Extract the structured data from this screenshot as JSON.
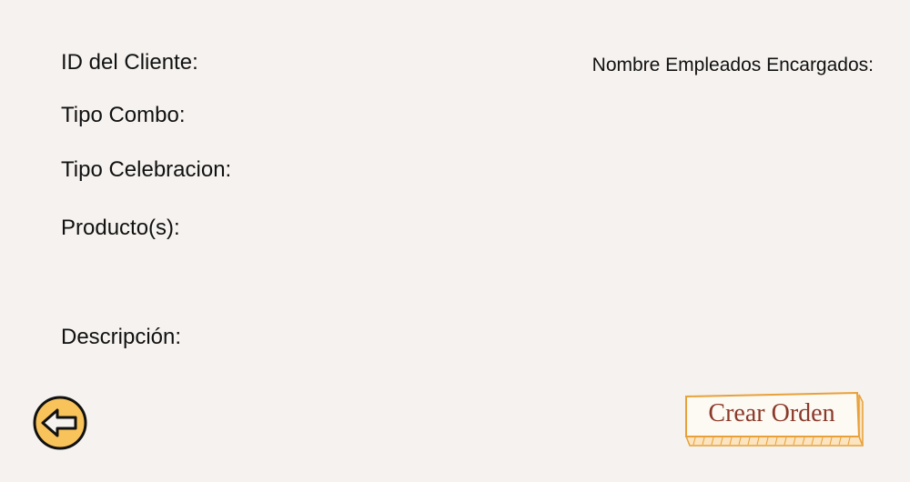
{
  "form": {
    "id_cliente_label": "ID del Cliente:",
    "tipo_combo_label": "Tipo Combo:",
    "tipo_celebracion_label": "Tipo Celebracion:",
    "productos_label": "Producto(s):",
    "descripcion_label": "Descripción:",
    "empleados_label": "Nombre Empleados Encargados:"
  },
  "actions": {
    "crear_orden_label": "Crear Orden",
    "back_icon": "arrow-left-icon"
  },
  "colors": {
    "background": "#f5f2ef",
    "back_button_fill": "#f8c35a",
    "crear_border": "#e8a13a",
    "crear_text": "#8a3a2a"
  }
}
